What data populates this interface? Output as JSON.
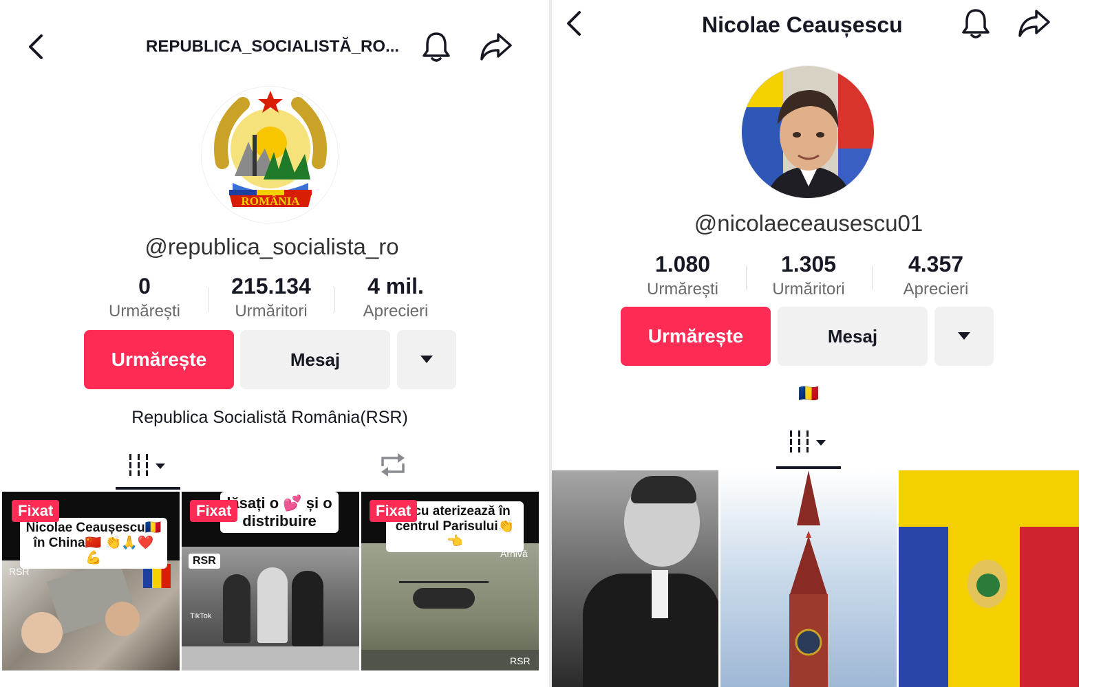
{
  "left": {
    "header": {
      "back_icon": "chevron-left-icon",
      "title": "REPUBLICA_SOCIALISTĂ_RO...",
      "bell_icon": "bell-icon",
      "share_icon": "share-icon"
    },
    "profile": {
      "avatar_text": "ROMÂNIA",
      "handle": "@republica_socialista_ro",
      "stats": [
        {
          "value": "0",
          "label": "Urmărești"
        },
        {
          "value": "215.134",
          "label": "Urmăritori"
        },
        {
          "value": "4 mil.",
          "label": "Aprecieri"
        }
      ],
      "follow_label": "Urmărește",
      "message_label": "Mesaj",
      "more_icon": "caret-down-icon",
      "bio": "Republica Socialistă România(RSR)"
    },
    "tabs": {
      "videos_icon": "grid-icon",
      "reposts_icon": "repost-icon"
    },
    "videos": [
      {
        "pinned": "Fixat",
        "caption": "Nicolae Ceaușescu🇷🇴 în China🇨🇳 👏🙏❤️💪",
        "tag": "RSR"
      },
      {
        "pinned": "Fixat",
        "caption": "lăsați o 💕 și o distribuire",
        "tag": "RSR",
        "watermark": "TikTok"
      },
      {
        "pinned": "Fixat",
        "caption": "escu aterizează în centrul Parisului👏👈",
        "tag": "RSR",
        "corner": "Arhivă"
      }
    ]
  },
  "right": {
    "header": {
      "back_icon": "chevron-left-icon",
      "title": "Nicolae Ceaușescu",
      "bell_icon": "bell-icon",
      "share_icon": "share-icon"
    },
    "profile": {
      "handle": "@nicolaeceausescu01",
      "stats": [
        {
          "value": "1.080",
          "label": "Urmărești"
        },
        {
          "value": "1.305",
          "label": "Urmăritori"
        },
        {
          "value": "4.357",
          "label": "Aprecieri"
        }
      ],
      "follow_label": "Urmărește",
      "message_label": "Mesaj",
      "more_icon": "caret-down-icon",
      "bio_flag": "🇷🇴"
    },
    "tabs": {
      "videos_icon": "grid-icon"
    }
  },
  "colors": {
    "accent": "#fe2c55",
    "secondary_btn": "#f1f1f2",
    "text": "#161823",
    "muted": "#6a6a6a"
  }
}
